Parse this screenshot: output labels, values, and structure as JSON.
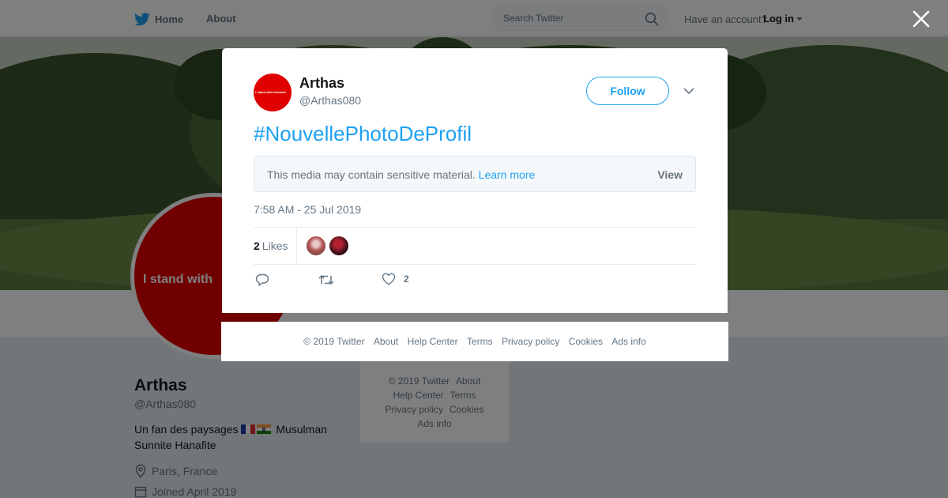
{
  "nav": {
    "home_label": "Home",
    "about_label": "About",
    "search_placeholder": "Search Twitter",
    "account_prompt": "Have an account?",
    "login_label": "Log in"
  },
  "colors": {
    "brand_blue": "#1da1f2",
    "avatar_red": "#e00000",
    "secondary_text": "#657786"
  },
  "profile": {
    "avatar_text": "I stand with",
    "name": "Arthas",
    "handle": "@Arthas080",
    "bio_before": "Un fan des paysages",
    "bio_flags": [
      "🇫🇷",
      "🇮🇳"
    ],
    "bio_after": "Musulman Sunnite Hanafite",
    "location": "Paris, France",
    "joined": "Joined April 2019"
  },
  "side_footer": [
    "© 2019 Twitter",
    "About",
    "Help Center",
    "Terms",
    "Privacy policy",
    "Cookies",
    "Ads info"
  ],
  "tweet": {
    "avatar_text": "I stand with Kashmir",
    "author_name": "Arthas",
    "author_handle": "@Arthas080",
    "follow_label": "Follow",
    "text": "#NouvellePhotoDeProfil",
    "sensitive_notice": "This media may contain sensitive material.",
    "learn_more_label": "Learn more",
    "view_label": "View",
    "timestamp": "7:58 AM - 25 Jul 2019",
    "likes_count": "2",
    "likes_label": "Likes",
    "action_like_count": "2"
  },
  "modal_footer": [
    "© 2019 Twitter",
    "About",
    "Help Center",
    "Terms",
    "Privacy policy",
    "Cookies",
    "Ads info"
  ],
  "icons": [
    "twitter-bird-icon",
    "search-icon",
    "close-icon",
    "chevron-down-icon",
    "location-pin-icon",
    "calendar-icon",
    "reply-icon",
    "retweet-icon",
    "heart-icon"
  ]
}
